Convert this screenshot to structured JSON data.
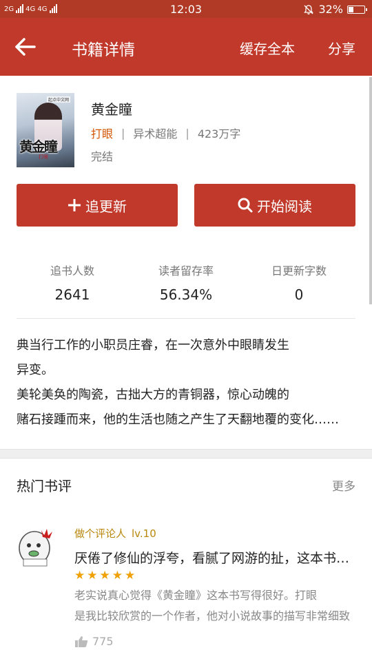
{
  "status_bar": {
    "network_left": "2G",
    "network_mid": "4G 4G",
    "time": "12:03",
    "battery_text": "32%",
    "battery_level": 0.32
  },
  "nav": {
    "title": "书籍详情",
    "cache_label": "缓存全本",
    "share_label": "分享"
  },
  "book": {
    "cover_tag": "起点中文网",
    "cover_title": "黄金瞳",
    "cover_author": "打眼",
    "title": "黄金瞳",
    "author": "打眼",
    "separator": "|",
    "category": "异术超能",
    "word_count": "423万字",
    "status": "完结"
  },
  "actions": {
    "follow_label": "追更新",
    "read_label": "开始阅读"
  },
  "stats": [
    {
      "label": "追书人数",
      "value": "2641"
    },
    {
      "label": "读者留存率",
      "value": "56.34%"
    },
    {
      "label": "日更新字数",
      "value": "0"
    }
  ],
  "description": {
    "line1": "典当行工作的小职员庄睿，在一次意外中眼睛发生",
    "line2": "异变。",
    "line3": "美轮美奂的陶瓷，古拙大方的青铜器，惊心动魄的",
    "line4": "赌石接踵而来，他的生活也随之产生了天翻地覆的变化……"
  },
  "reviews": {
    "section_title": "热门书评",
    "more_label": "更多",
    "items": [
      {
        "user": "做个评论人",
        "level": "lv.10",
        "title": "厌倦了修仙的浮夸，看腻了网游的扯，这本书让人眼前一亮",
        "rating": 5,
        "stars": "★★★★★",
        "body_line1": "老实说真心觉得《黄金瞳》这本书写得很好。打眼",
        "body_line2": "是我比较欣赏的一个作者，他对小说故事的描写非常细致",
        "likes": "775"
      }
    ]
  },
  "colors": {
    "primary": "#c0392b",
    "status_bar": "#b03a25",
    "author_accent": "#d35400",
    "star": "#f0a000",
    "reviewer": "#b8860b"
  }
}
